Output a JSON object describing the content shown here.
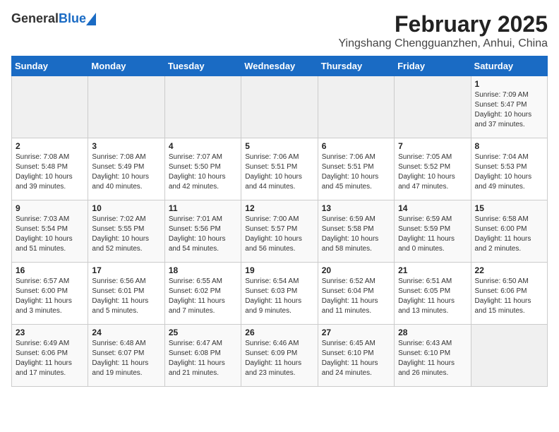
{
  "header": {
    "logo_general": "General",
    "logo_blue": "Blue",
    "title": "February 2025",
    "subtitle": "Yingshang Chengguanzhen, Anhui, China"
  },
  "weekdays": [
    "Sunday",
    "Monday",
    "Tuesday",
    "Wednesday",
    "Thursday",
    "Friday",
    "Saturday"
  ],
  "weeks": [
    [
      {
        "day": "",
        "info": ""
      },
      {
        "day": "",
        "info": ""
      },
      {
        "day": "",
        "info": ""
      },
      {
        "day": "",
        "info": ""
      },
      {
        "day": "",
        "info": ""
      },
      {
        "day": "",
        "info": ""
      },
      {
        "day": "1",
        "info": "Sunrise: 7:09 AM\nSunset: 5:47 PM\nDaylight: 10 hours\nand 37 minutes."
      }
    ],
    [
      {
        "day": "2",
        "info": "Sunrise: 7:08 AM\nSunset: 5:48 PM\nDaylight: 10 hours\nand 39 minutes."
      },
      {
        "day": "3",
        "info": "Sunrise: 7:08 AM\nSunset: 5:49 PM\nDaylight: 10 hours\nand 40 minutes."
      },
      {
        "day": "4",
        "info": "Sunrise: 7:07 AM\nSunset: 5:50 PM\nDaylight: 10 hours\nand 42 minutes."
      },
      {
        "day": "5",
        "info": "Sunrise: 7:06 AM\nSunset: 5:51 PM\nDaylight: 10 hours\nand 44 minutes."
      },
      {
        "day": "6",
        "info": "Sunrise: 7:06 AM\nSunset: 5:51 PM\nDaylight: 10 hours\nand 45 minutes."
      },
      {
        "day": "7",
        "info": "Sunrise: 7:05 AM\nSunset: 5:52 PM\nDaylight: 10 hours\nand 47 minutes."
      },
      {
        "day": "8",
        "info": "Sunrise: 7:04 AM\nSunset: 5:53 PM\nDaylight: 10 hours\nand 49 minutes."
      }
    ],
    [
      {
        "day": "9",
        "info": "Sunrise: 7:03 AM\nSunset: 5:54 PM\nDaylight: 10 hours\nand 51 minutes."
      },
      {
        "day": "10",
        "info": "Sunrise: 7:02 AM\nSunset: 5:55 PM\nDaylight: 10 hours\nand 52 minutes."
      },
      {
        "day": "11",
        "info": "Sunrise: 7:01 AM\nSunset: 5:56 PM\nDaylight: 10 hours\nand 54 minutes."
      },
      {
        "day": "12",
        "info": "Sunrise: 7:00 AM\nSunset: 5:57 PM\nDaylight: 10 hours\nand 56 minutes."
      },
      {
        "day": "13",
        "info": "Sunrise: 6:59 AM\nSunset: 5:58 PM\nDaylight: 10 hours\nand 58 minutes."
      },
      {
        "day": "14",
        "info": "Sunrise: 6:59 AM\nSunset: 5:59 PM\nDaylight: 11 hours\nand 0 minutes."
      },
      {
        "day": "15",
        "info": "Sunrise: 6:58 AM\nSunset: 6:00 PM\nDaylight: 11 hours\nand 2 minutes."
      }
    ],
    [
      {
        "day": "16",
        "info": "Sunrise: 6:57 AM\nSunset: 6:00 PM\nDaylight: 11 hours\nand 3 minutes."
      },
      {
        "day": "17",
        "info": "Sunrise: 6:56 AM\nSunset: 6:01 PM\nDaylight: 11 hours\nand 5 minutes."
      },
      {
        "day": "18",
        "info": "Sunrise: 6:55 AM\nSunset: 6:02 PM\nDaylight: 11 hours\nand 7 minutes."
      },
      {
        "day": "19",
        "info": "Sunrise: 6:54 AM\nSunset: 6:03 PM\nDaylight: 11 hours\nand 9 minutes."
      },
      {
        "day": "20",
        "info": "Sunrise: 6:52 AM\nSunset: 6:04 PM\nDaylight: 11 hours\nand 11 minutes."
      },
      {
        "day": "21",
        "info": "Sunrise: 6:51 AM\nSunset: 6:05 PM\nDaylight: 11 hours\nand 13 minutes."
      },
      {
        "day": "22",
        "info": "Sunrise: 6:50 AM\nSunset: 6:06 PM\nDaylight: 11 hours\nand 15 minutes."
      }
    ],
    [
      {
        "day": "23",
        "info": "Sunrise: 6:49 AM\nSunset: 6:06 PM\nDaylight: 11 hours\nand 17 minutes."
      },
      {
        "day": "24",
        "info": "Sunrise: 6:48 AM\nSunset: 6:07 PM\nDaylight: 11 hours\nand 19 minutes."
      },
      {
        "day": "25",
        "info": "Sunrise: 6:47 AM\nSunset: 6:08 PM\nDaylight: 11 hours\nand 21 minutes."
      },
      {
        "day": "26",
        "info": "Sunrise: 6:46 AM\nSunset: 6:09 PM\nDaylight: 11 hours\nand 23 minutes."
      },
      {
        "day": "27",
        "info": "Sunrise: 6:45 AM\nSunset: 6:10 PM\nDaylight: 11 hours\nand 24 minutes."
      },
      {
        "day": "28",
        "info": "Sunrise: 6:43 AM\nSunset: 6:10 PM\nDaylight: 11 hours\nand 26 minutes."
      },
      {
        "day": "",
        "info": ""
      }
    ]
  ]
}
